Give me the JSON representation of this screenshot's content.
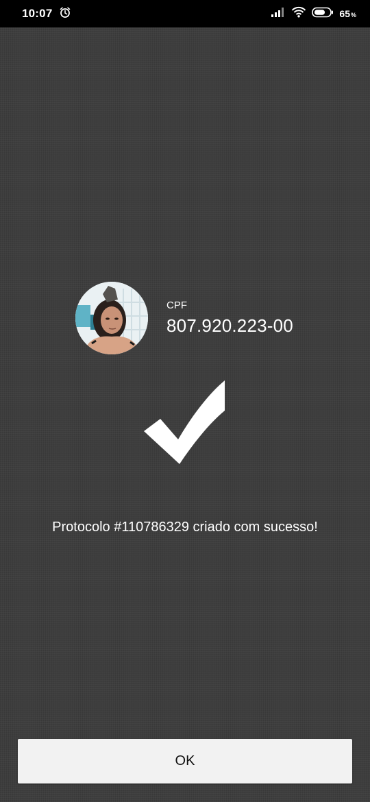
{
  "status_bar": {
    "time": "10:07",
    "battery_percent": "65",
    "battery_unit": "%",
    "icons": [
      "alarm-icon",
      "signal-icon",
      "wifi-icon",
      "battery-icon"
    ]
  },
  "profile": {
    "cpf_label": "CPF",
    "cpf_value": "807.920.223-00"
  },
  "confirmation": {
    "icon": "checkmark-icon",
    "message": "Protocolo #110786329 criado com sucesso!"
  },
  "actions": {
    "ok_label": "OK"
  },
  "colors": {
    "background": "#3e3e3e",
    "status_bar": "#000000",
    "button": "#f2f2f2",
    "text": "#ffffff"
  }
}
